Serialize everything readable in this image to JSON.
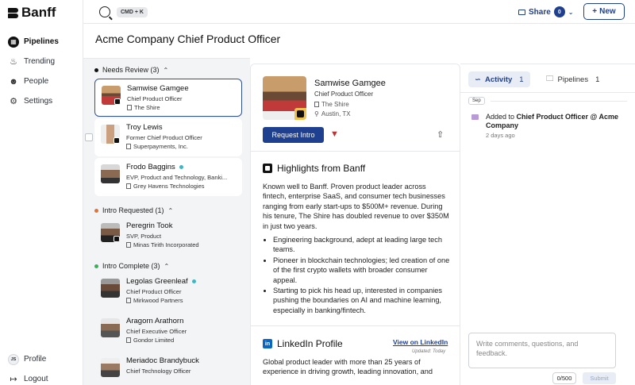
{
  "app": {
    "name": "Banff"
  },
  "sidebar": {
    "items": [
      {
        "label": "Pipelines",
        "icon": "pipelines-icon"
      },
      {
        "label": "Trending",
        "icon": "flame-icon"
      },
      {
        "label": "People",
        "icon": "people-icon"
      },
      {
        "label": "Settings",
        "icon": "gear-icon"
      }
    ],
    "profile": {
      "initials": "JS",
      "label": "Profile"
    },
    "logout": "Logout"
  },
  "topbar": {
    "search_shortcut": "CMD + K",
    "share_label": "Share",
    "share_count": "0",
    "new_label": "New"
  },
  "page_title": "Acme Company Chief Product Officer",
  "groups": [
    {
      "label": "Needs Review (3)",
      "color": "#111111",
      "candidates": [
        {
          "name": "Samwise Gamgee",
          "role": "Chief Product Officer",
          "company": "The Shire"
        },
        {
          "name": "Troy Lewis",
          "role": "Former Chief Product Officer",
          "company": "Superpayments, Inc."
        },
        {
          "name": "Frodo Baggins",
          "role": "EVP, Product and Technology, Banki...",
          "company": "Grey Havens Technologies"
        }
      ]
    },
    {
      "label": "Intro Requested (1)",
      "color": "#e0733a",
      "candidates": [
        {
          "name": "Peregrin Took",
          "role": "SVP, Product",
          "company": "Minas Tirith Incorporated"
        }
      ]
    },
    {
      "label": "Intro Complete (3)",
      "color": "#3fae5a",
      "candidates": [
        {
          "name": "Legolas Greenleaf",
          "role": "Chief Product Officer",
          "company": "Mirkwood Partners"
        },
        {
          "name": "Aragorn Arathorn",
          "role": "Chief Executive Officer",
          "company": "Gondor Limited"
        },
        {
          "name": "Meriadoc Brandybuck",
          "role": "Chief Technology Officer",
          "company": ""
        }
      ]
    }
  ],
  "detail": {
    "name": "Samwise Gamgee",
    "role": "Chief Product Officer",
    "company": "The Shire",
    "location": "Austin, TX",
    "request_intro": "Request Intro",
    "highlights_title": "Highlights from Banff",
    "highlights_text": "Known well to Banff. Proven product leader across fintech, enterprise SaaS, and consumer tech businesses ranging from early start-ups to $500M+ revenue. During his tenure, The Shire has doubled revenue to over $350M in just two years.",
    "bullets": [
      "Engineering background, adept at leading large tech teams.",
      "Pioneer in blockchain technologies; led creation of one of the first crypto wallets with broader consumer appeal.",
      "Starting to pick his head up, interested in companies pushing the boundaries on AI and machine learning, especially in banking/fintech."
    ],
    "linkedin_title": "LinkedIn Profile",
    "linkedin_link": "View on LinkedIn",
    "linkedin_updated": "Updated: Today",
    "linkedin_text": "Global product leader with more than 25 years of experience in driving growth, leading innovation, and"
  },
  "activity": {
    "tab_activity": "Activity",
    "tab_activity_count": "1",
    "tab_pipelines": "Pipelines",
    "tab_pipelines_count": "1",
    "month": "Sep",
    "event_prefix": "Added to ",
    "event_target": "Chief Product Officer @ Acme Company",
    "event_ago": "2 days ago",
    "comment_placeholder": "Write comments, questions, and feedback.",
    "counter": "0/500",
    "submit": "Submit"
  }
}
